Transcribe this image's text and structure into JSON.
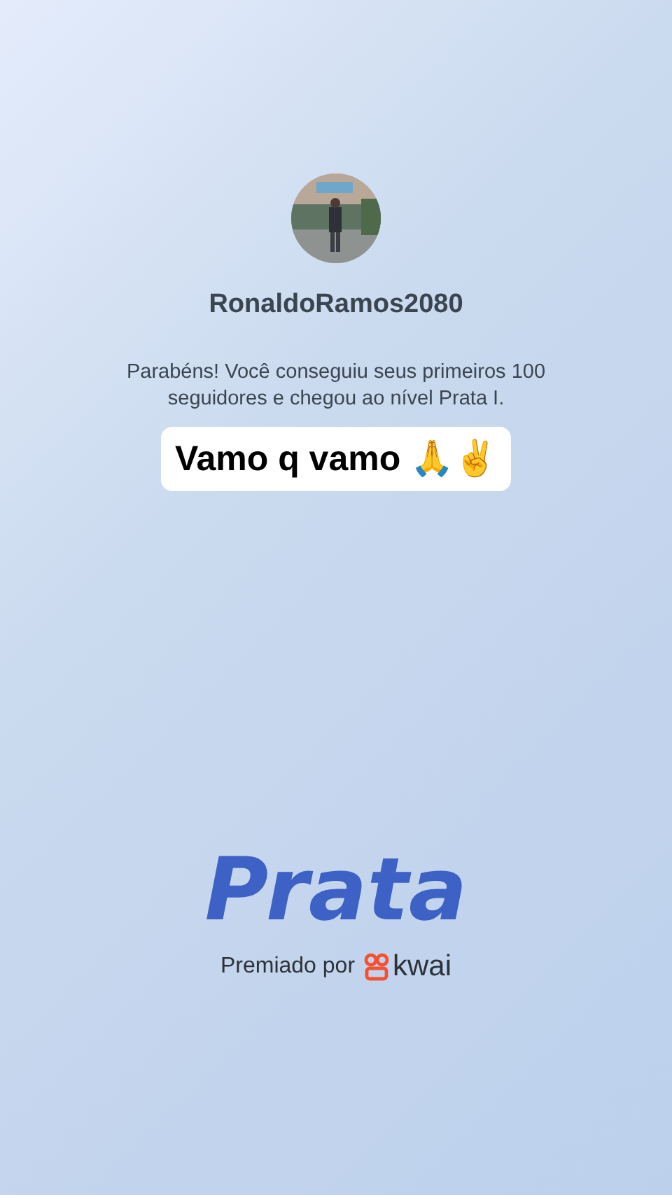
{
  "profile": {
    "username": "RonaldoRamos2080"
  },
  "message": "Parabéns! Você conseguiu seus primeiros 100 seguidores e chegou ao nível Prata I.",
  "caption": "Vamo q vamo 🙏✌️",
  "level_title": "Prata",
  "awarded_by": {
    "label": "Premiado por",
    "brand": "kwai"
  }
}
